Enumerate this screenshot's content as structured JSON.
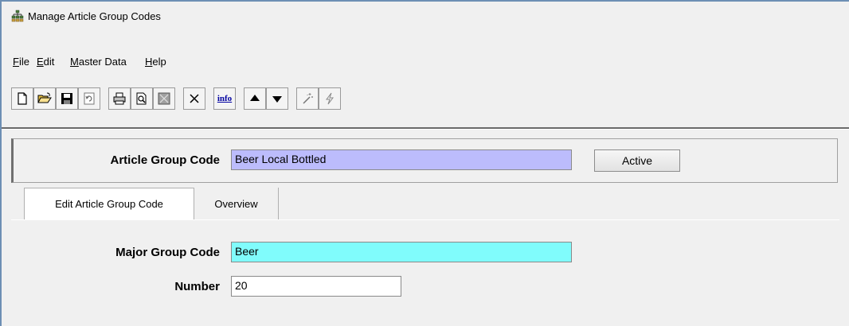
{
  "window": {
    "title": "Manage Article Group Codes",
    "icon": "hierarchy-icon"
  },
  "menu": [
    {
      "label": "File"
    },
    {
      "label": "Edit"
    },
    {
      "label": "Master Data"
    },
    {
      "label": "Help"
    }
  ],
  "toolbar": {
    "buttons": [
      {
        "name": "new-icon"
      },
      {
        "name": "open-folder-icon"
      },
      {
        "name": "save-icon"
      },
      {
        "name": "refresh-icon"
      },
      {
        "name": "print-icon"
      },
      {
        "name": "print-preview-icon"
      },
      {
        "name": "export-icon"
      },
      {
        "name": "delete-icon"
      },
      {
        "name": "info-icon",
        "label": "info"
      },
      {
        "name": "arrow-up-icon"
      },
      {
        "name": "arrow-down-icon"
      },
      {
        "name": "magic-wand-icon"
      },
      {
        "name": "lightning-icon"
      }
    ]
  },
  "header": {
    "article_group_code_label": "Article Group Code",
    "article_group_code_value": "Beer Local Bottled",
    "active_button": "Active"
  },
  "tabs": [
    {
      "label": "Edit Article Group Code",
      "active": true
    },
    {
      "label": "Overview",
      "active": false
    }
  ],
  "form": {
    "major_group_code_label": "Major Group Code",
    "major_group_code_value": "Beer",
    "number_label": "Number",
    "number_value": "20"
  },
  "colors": {
    "window_border": "#6d8fb4",
    "article_field_bg": "#bcbcfc",
    "major_field_bg": "#80fcfc",
    "number_field_bg": "#ffffff"
  }
}
